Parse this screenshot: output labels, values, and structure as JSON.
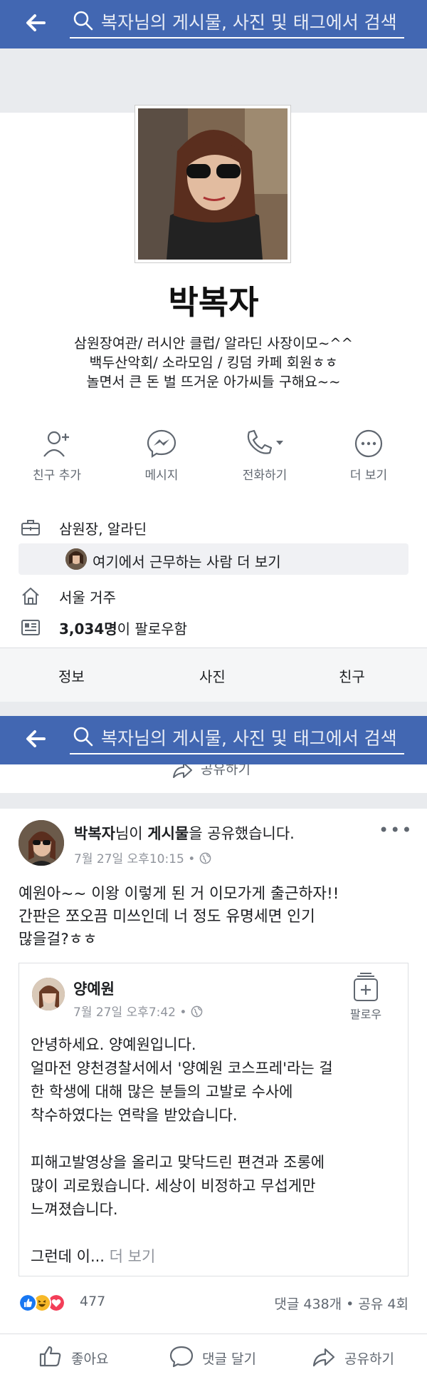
{
  "search": {
    "placeholder": "복자님의 게시물, 사진 및 태그에서 검색"
  },
  "profile": {
    "name": "박복자",
    "bio": [
      "삼원장여관/ 러시안 클럽/ 알라딘 사장이모~^^",
      "백두산악회/ 소라모임 / 킹덤 카페 회원ㅎㅎ",
      "놀면서 큰 돈 벌 뜨거운 아가씨들 구해요~~"
    ]
  },
  "actions": [
    {
      "label": "친구 추가",
      "icon": "add-friend-icon"
    },
    {
      "label": "메시지",
      "icon": "messenger-icon"
    },
    {
      "label": "전화하기",
      "icon": "phone-icon"
    },
    {
      "label": "더 보기",
      "icon": "more-icon"
    }
  ],
  "info": {
    "work": "삼원장, 알라딘",
    "coworkers": "여기에서 근무하는 사람 더 보기",
    "lives": "서울 거주",
    "followers_count": "3,034명",
    "followers_suffix": "이 팔로우함"
  },
  "tabs": [
    "정보",
    "사진",
    "친구"
  ],
  "partial_share_label": "공유하기",
  "post": {
    "author": "박복자",
    "action_pre": "님이 ",
    "action_obj": "게시물",
    "action_post": "을 공유했습니다.",
    "time": "7월 27일 오후10:15 • ",
    "text": [
      "예원아~~ 이왕 이렇게 된 거 이모가게 출근하자!!",
      "간판은 쪼오끔 미쓰인데 너 정도 유명세면 인기",
      "많을걸?ㅎㅎ"
    ],
    "shared": {
      "author": "양예원",
      "time": "7월 27일 오후7:42 • ",
      "follow_label": "팔로우",
      "text": "안녕하세요. 양예원입니다.\n얼마전 양천경찰서에서 '양예원 코스프레'라는 걸\n한 학생에 대해 많은 분들의 고발로 수사에\n착수하였다는 연락을 받았습니다.\n\n피해고발영상을 올리고 맞닥드린 편견과 조롱에\n많이  괴로웠습니다. 세상이 비정하고 무섭게만\n느껴졌습니다.\n\n그런데 이... ",
      "see_more": "더 보기"
    },
    "reactions_count": "477",
    "comments_shares": "댓글 438개 • 공유 4회",
    "buttons": [
      {
        "label": "좋아요",
        "icon": "like-icon"
      },
      {
        "label": "댓글 달기",
        "icon": "comment-icon"
      },
      {
        "label": "공유하기",
        "icon": "share-icon"
      }
    ]
  },
  "colors": {
    "brand": "#4267b2",
    "like": "#1877f2",
    "haha": "#f7b928",
    "love": "#f33e58"
  }
}
